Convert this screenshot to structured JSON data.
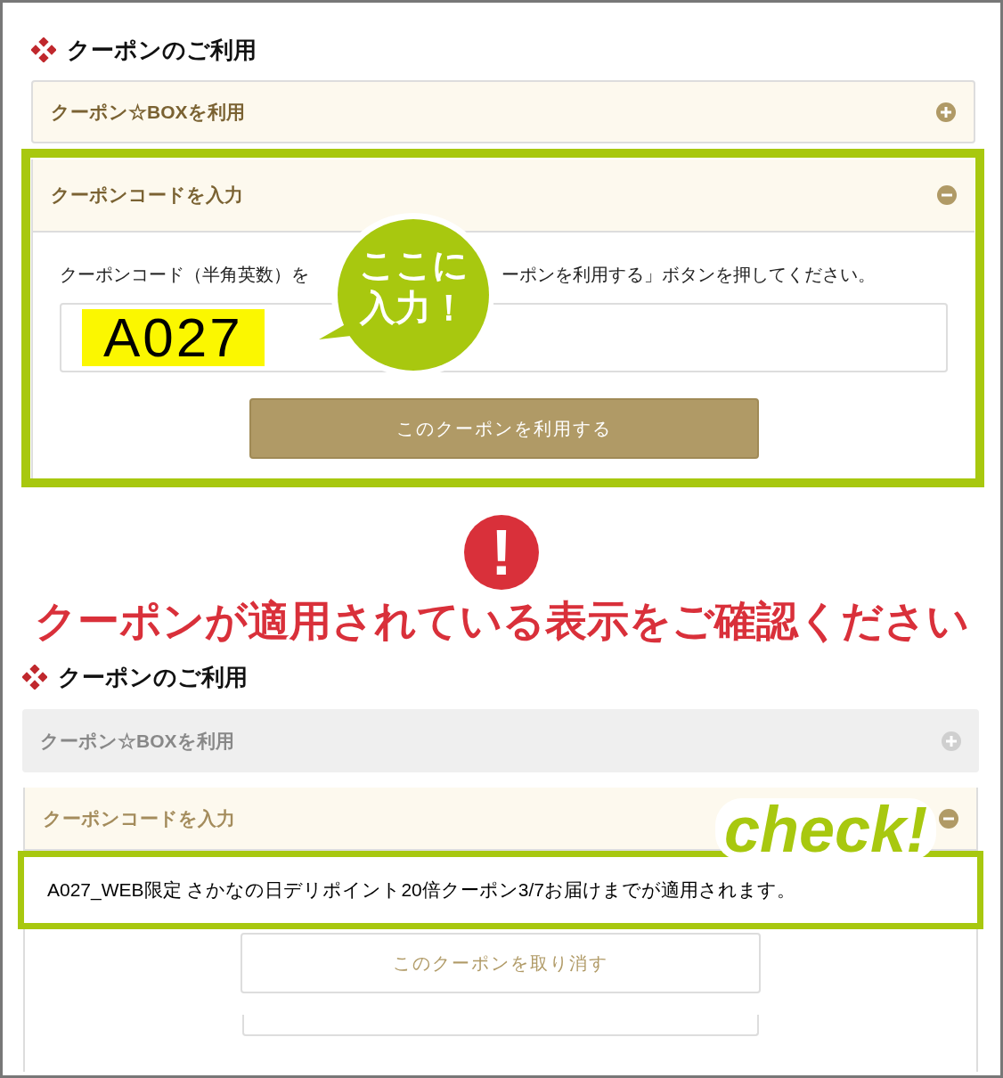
{
  "entry_screen": {
    "heading": "クーポンのご利用",
    "accordions": [
      {
        "label": "クーポン☆BOXを利用",
        "expanded": false,
        "muted": false
      },
      {
        "label": "クーポンコードを入力",
        "expanded": true,
        "muted": false
      }
    ],
    "instruction_parts": [
      "クーポンコード（半角英数）を",
      "ーポンを利用する」ボタンを押してください。"
    ],
    "code_field": {
      "value": "A027"
    },
    "callout": [
      "ここに",
      "入力！"
    ],
    "apply_button": "このクーポンを利用する"
  },
  "notice": {
    "icon": "!",
    "message": "クーポンが適用されている表示をご確認ください"
  },
  "applied_screen": {
    "heading": "クーポンのご利用",
    "accordions": [
      {
        "label": "クーポン☆BOXを利用",
        "expanded": false,
        "muted": true
      },
      {
        "label": "クーポンコードを入力",
        "expanded": true,
        "muted": false
      }
    ],
    "applied_message": "A027_WEB限定 さかなの日デリポイント20倍クーポン3/7お届けまでが適用されます。",
    "callout": "check!",
    "cancel_button": "このクーポンを取り消す"
  }
}
